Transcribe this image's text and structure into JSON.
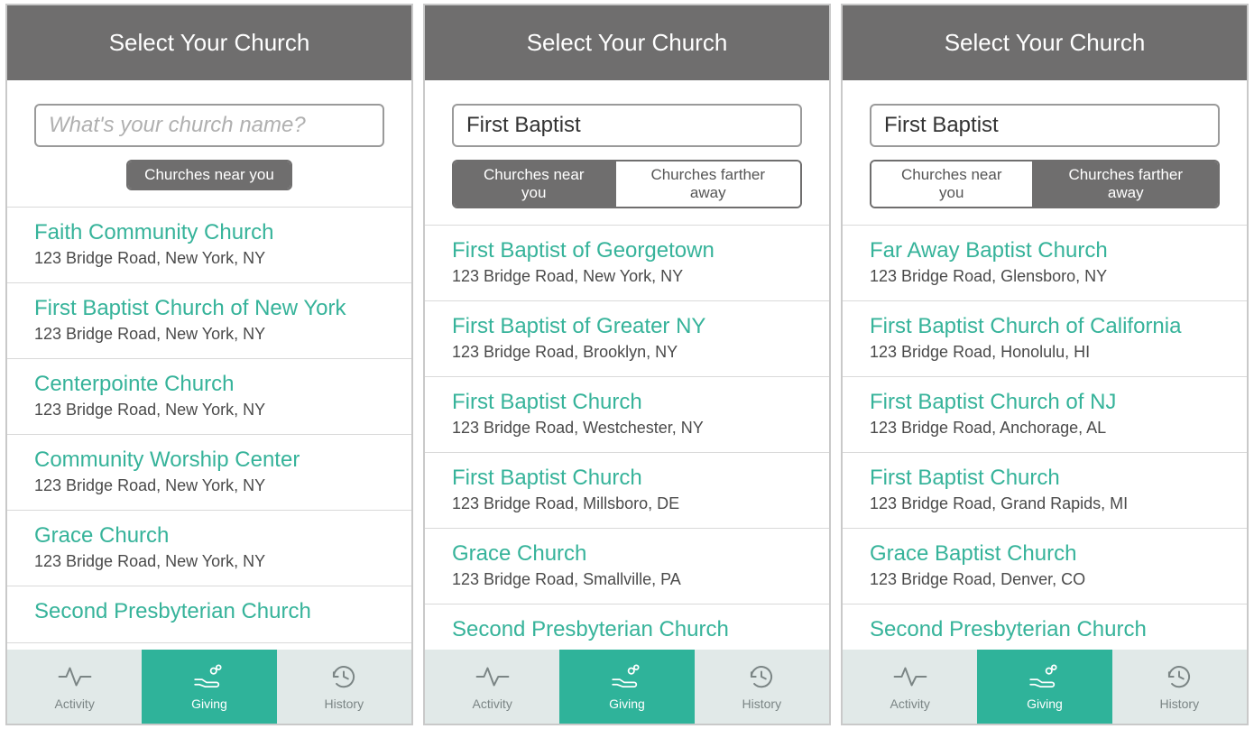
{
  "colors": {
    "accent": "#2fb39a",
    "headerGrey": "#6f6e6e",
    "tabGrey": "#e1e9e8"
  },
  "headerTitle": "Select Your Church",
  "searchPlaceholder": "What's your church name?",
  "segLabels": {
    "near": "Churches near you",
    "far": "Churches farther away"
  },
  "tabLabels": {
    "activity": "Activity",
    "giving": "Giving",
    "history": "History"
  },
  "panels": [
    {
      "searchValue": "",
      "showFarSegment": false,
      "activeSegment": "near",
      "churches": [
        {
          "name": "Faith Community Church",
          "addr": "123 Bridge Road, New York, NY"
        },
        {
          "name": "First Baptist Church of New York",
          "addr": "123 Bridge Road, New York, NY"
        },
        {
          "name": "Centerpointe Church",
          "addr": "123 Bridge Road, New York, NY"
        },
        {
          "name": "Community Worship Center",
          "addr": "123 Bridge Road, New York, NY"
        },
        {
          "name": "Grace Church",
          "addr": "123 Bridge Road, New York, NY"
        },
        {
          "name": "Second Presbyterian Church",
          "addr": ""
        }
      ]
    },
    {
      "searchValue": "First Baptist",
      "showFarSegment": true,
      "activeSegment": "near",
      "churches": [
        {
          "name": "First Baptist of Georgetown",
          "addr": "123 Bridge Road, New York, NY"
        },
        {
          "name": "First Baptist of Greater NY",
          "addr": "123 Bridge Road, Brooklyn, NY"
        },
        {
          "name": "First Baptist Church",
          "addr": "123 Bridge Road, Westchester, NY"
        },
        {
          "name": "First Baptist Church",
          "addr": "123 Bridge Road, Millsboro, DE"
        },
        {
          "name": "Grace Church",
          "addr": "123 Bridge Road, Smallville, PA"
        },
        {
          "name": "Second Presbyterian Church",
          "addr": ""
        }
      ]
    },
    {
      "searchValue": "First Baptist",
      "showFarSegment": true,
      "activeSegment": "far",
      "churches": [
        {
          "name": "Far Away Baptist Church",
          "addr": "123 Bridge Road, Glensboro, NY"
        },
        {
          "name": "First Baptist Church of California",
          "addr": "123 Bridge Road, Honolulu, HI"
        },
        {
          "name": "First Baptist Church of NJ",
          "addr": "123 Bridge Road, Anchorage, AL"
        },
        {
          "name": "First Baptist Church",
          "addr": "123 Bridge Road, Grand Rapids, MI"
        },
        {
          "name": "Grace Baptist Church",
          "addr": "123 Bridge Road, Denver, CO"
        },
        {
          "name": "Second Presbyterian Church",
          "addr": ""
        }
      ]
    }
  ]
}
